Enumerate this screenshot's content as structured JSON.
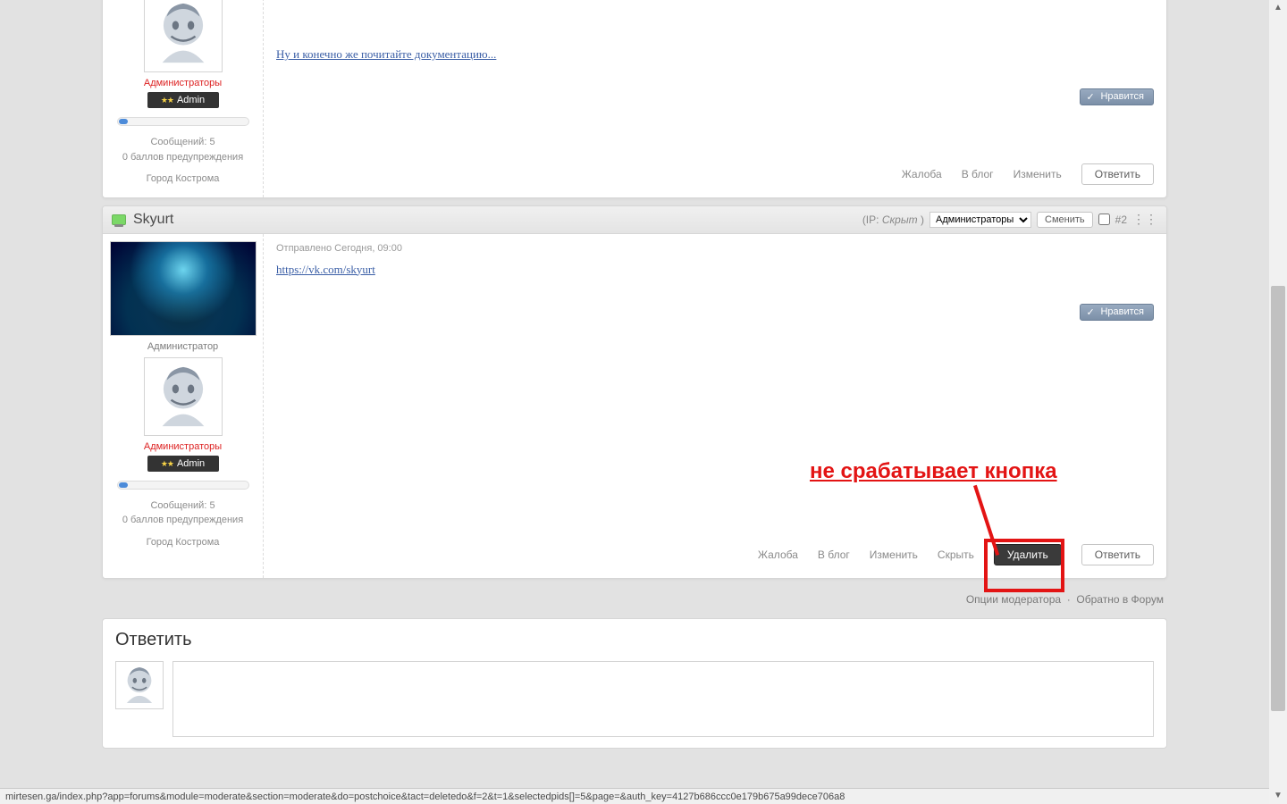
{
  "post1": {
    "group": "Администраторы",
    "badge": "Admin",
    "msg_count": "Сообщений: 5",
    "warn": "0 баллов предупреждения",
    "city": "Город Кострома",
    "doc_link": "Ну и конечно же почитайте документацию...",
    "like": "Нравится",
    "actions": {
      "report": "Жалоба",
      "blog": "В блог",
      "edit": "Изменить",
      "reply": "Ответить"
    }
  },
  "post2": {
    "username": "Skyurt",
    "ip_label": "(IP: ",
    "ip_hidden": "Скрыт",
    "ip_close": " )",
    "dropdown": "Администраторы",
    "change": "Сменить",
    "postnum": "#2",
    "time": "Отправлено Сегодня, 09:00",
    "link": "https://vk.com/skyurt",
    "role": "Администратор",
    "group": "Администраторы",
    "badge": "Admin",
    "msg_count": "Сообщений: 5",
    "warn": "0 баллов предупреждения",
    "city": "Город Кострома",
    "like": "Нравится",
    "actions": {
      "report": "Жалоба",
      "blog": "В блог",
      "edit": "Изменить",
      "hide": "Скрыть",
      "delete": "Удалить",
      "reply": "Ответить"
    }
  },
  "annotation": "не срабатывает кнопка",
  "footer": {
    "mod": "Опции модератора",
    "back": "Обратно в Форум"
  },
  "reply": {
    "title": "Ответить"
  },
  "statusbar": "mirtesen.ga/index.php?app=forums&module=moderate&section=moderate&do=postchoice&tact=deletedo&f=2&t=1&selectedpids[]=5&page=&auth_key=4127b686ccc0e179b675a99dece706a8"
}
